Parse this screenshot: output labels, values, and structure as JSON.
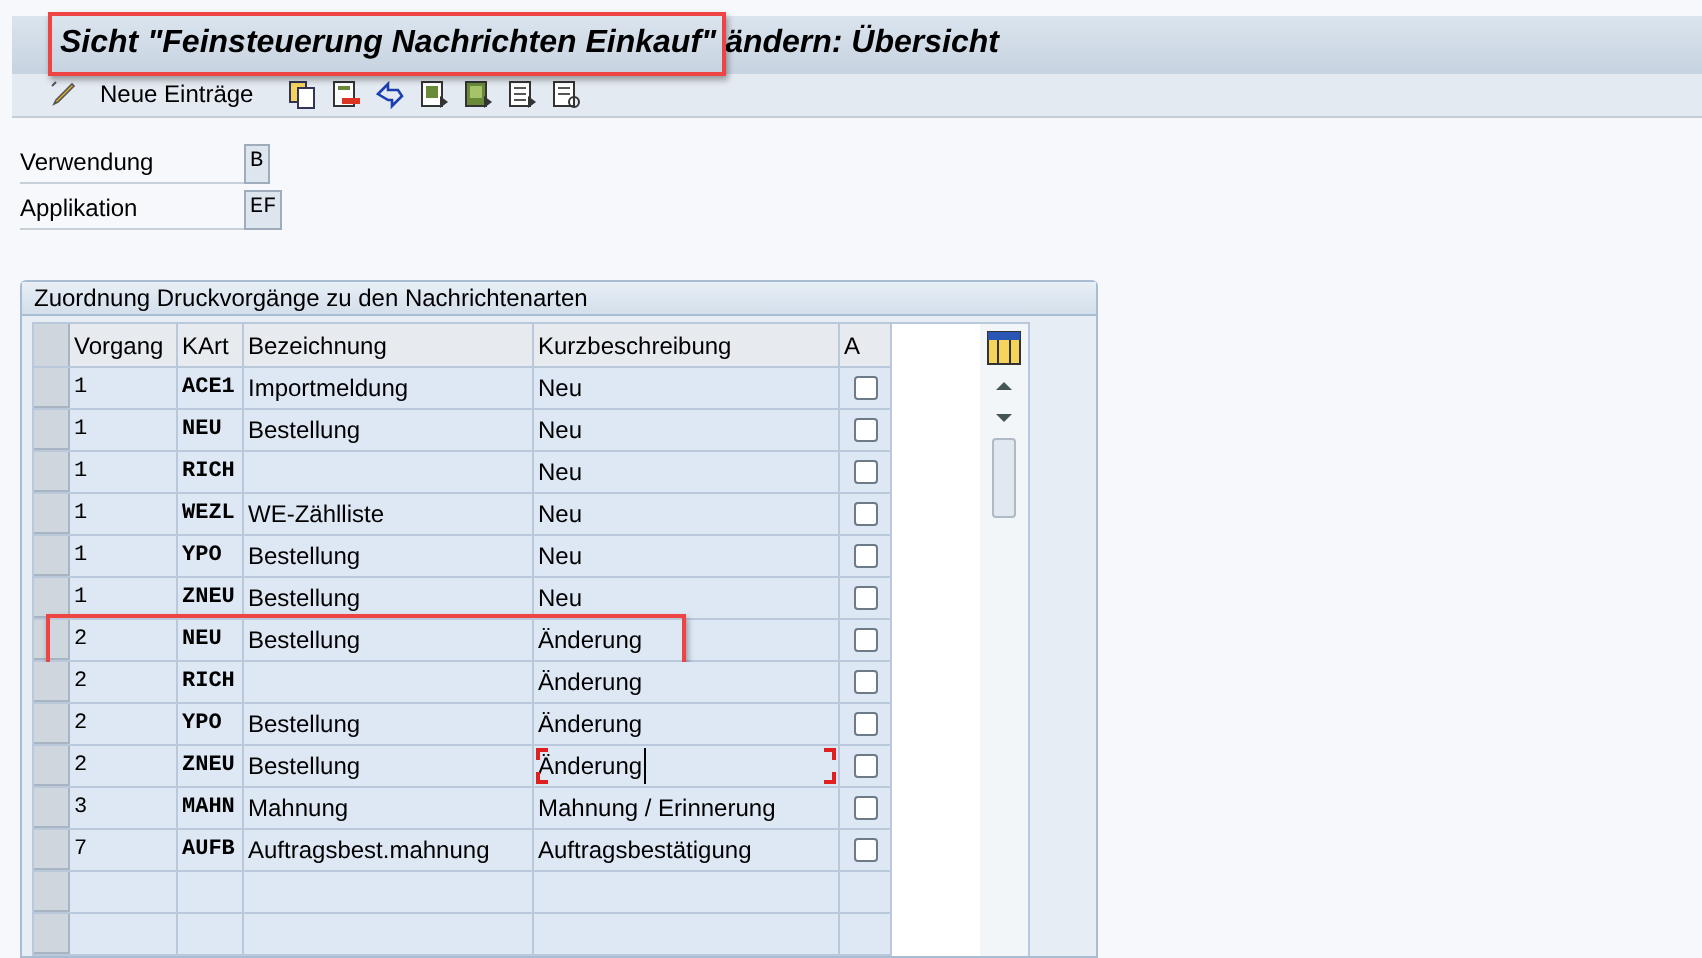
{
  "window": {
    "title": "Sicht \"Feinsteuerung Nachrichten Einkauf\" ändern: Übersicht",
    "highlighted": true
  },
  "toolbar": {
    "new_entries": "Neue Einträge"
  },
  "fields": [
    {
      "label": "Verwendung",
      "value": "B"
    },
    {
      "label": "Applikation",
      "value": "EF"
    }
  ],
  "group": {
    "title": "Zuordnung Druckvorgänge zu den Nachrichtenarten"
  },
  "table": {
    "columns": [
      "Vorgang",
      "KArt",
      "Bezeichnung",
      "Kurzbeschreibung",
      "A"
    ],
    "rows": [
      {
        "vorgang": "1",
        "kart": "ACE1",
        "bezeichnung": "Importmeldung",
        "kurz": "Neu",
        "checked": false,
        "highlighted": false,
        "focused": false
      },
      {
        "vorgang": "1",
        "kart": "NEU",
        "bezeichnung": "Bestellung",
        "kurz": "Neu",
        "checked": false,
        "highlighted": false,
        "focused": false
      },
      {
        "vorgang": "1",
        "kart": "RICH",
        "bezeichnung": "",
        "kurz": "Neu",
        "checked": false,
        "highlighted": false,
        "focused": false
      },
      {
        "vorgang": "1",
        "kart": "WEZL",
        "bezeichnung": "WE-Zählliste",
        "kurz": "Neu",
        "checked": false,
        "highlighted": false,
        "focused": false
      },
      {
        "vorgang": "1",
        "kart": "YPO",
        "bezeichnung": "Bestellung",
        "kurz": "Neu",
        "checked": false,
        "highlighted": false,
        "focused": false
      },
      {
        "vorgang": "1",
        "kart": "ZNEU",
        "bezeichnung": "Bestellung",
        "kurz": "Neu",
        "checked": false,
        "highlighted": false,
        "focused": false
      },
      {
        "vorgang": "2",
        "kart": "NEU",
        "bezeichnung": "Bestellung",
        "kurz": "Änderung",
        "checked": false,
        "highlighted": true,
        "focused": false
      },
      {
        "vorgang": "2",
        "kart": "RICH",
        "bezeichnung": "",
        "kurz": "Änderung",
        "checked": false,
        "highlighted": false,
        "focused": false
      },
      {
        "vorgang": "2",
        "kart": "YPO",
        "bezeichnung": "Bestellung",
        "kurz": "Änderung",
        "checked": false,
        "highlighted": false,
        "focused": false
      },
      {
        "vorgang": "2",
        "kart": "ZNEU",
        "bezeichnung": "Bestellung",
        "kurz": "Änderung",
        "checked": false,
        "highlighted": false,
        "focused": true
      },
      {
        "vorgang": "3",
        "kart": "MAHN",
        "bezeichnung": "Mahnung",
        "kurz": "Mahnung / Erinnerung",
        "checked": false,
        "highlighted": false,
        "focused": false
      },
      {
        "vorgang": "7",
        "kart": "AUFB",
        "bezeichnung": "Auftragsbest.mahnung",
        "kurz": "Auftragsbestätigung",
        "checked": false,
        "highlighted": false,
        "focused": false
      }
    ]
  }
}
